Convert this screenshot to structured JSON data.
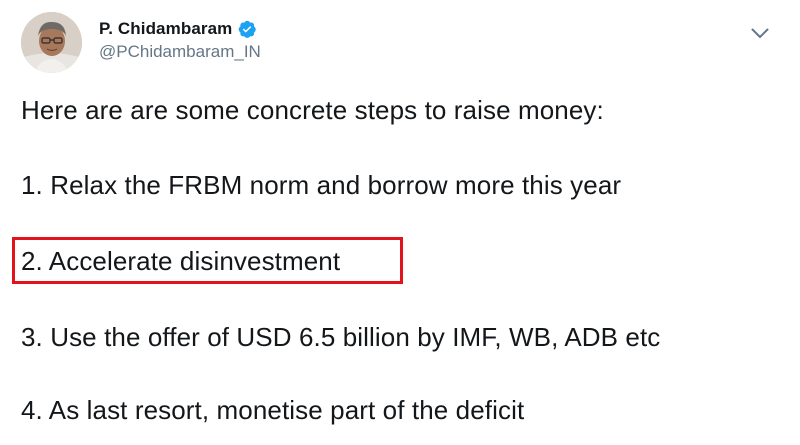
{
  "author": {
    "name": "P. Chidambaram",
    "handle": "@PChidambaram_IN",
    "verified": true
  },
  "tweet": {
    "lines": [
      "Here are are some concrete steps to raise money:",
      "1. Relax the FRBM norm and borrow more this year",
      "2. Accelerate disinvestment",
      "3. Use the offer of USD 6.5 billion by IMF, WB, ADB etc",
      "4. As last resort, monetise part of the deficit"
    ],
    "highlighted_line": 2
  },
  "icons": {
    "verified": "verified-badge-icon",
    "menu": "chevron-down-icon"
  },
  "colors": {
    "verified_blue": "#1da1f2",
    "highlight_red": "#e3131b",
    "handle_gray": "#657786",
    "text": "#14171a"
  }
}
